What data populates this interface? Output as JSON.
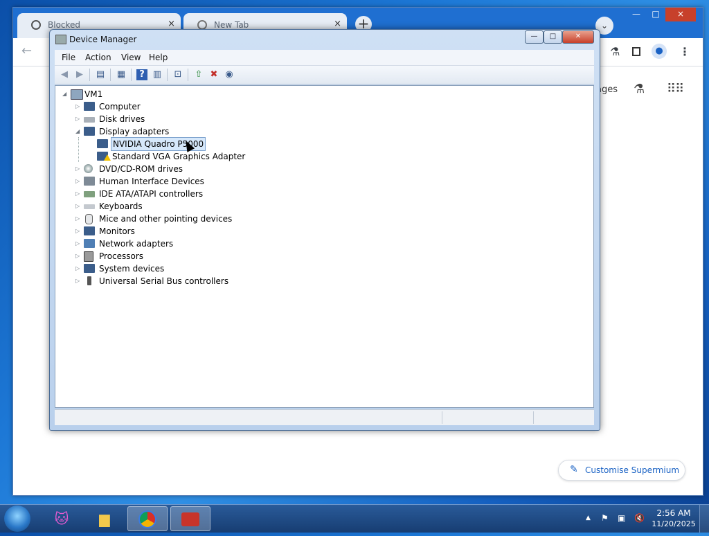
{
  "browser": {
    "tabs": [
      {
        "title": "Blocked",
        "icon": "blocked-icon",
        "close": "×"
      },
      {
        "title": "New Tab",
        "icon": "chrome-icon",
        "close": "×"
      }
    ],
    "new_tab": "+",
    "tab_search": "⌄",
    "window_controls": {
      "minimize": "—",
      "maximize": "□",
      "close": "×"
    },
    "toolbar": {
      "back": "←",
      "right_icons": [
        "flask-icon",
        "sidebar-icon",
        "profile-icon",
        "menu-icon"
      ]
    },
    "page": {
      "apps_label": "ages",
      "customise_label": "Customise Supermium"
    }
  },
  "device_manager": {
    "title": "Device Manager",
    "menu": [
      "File",
      "Action",
      "View",
      "Help"
    ],
    "window_controls": {
      "minimize": "—",
      "maximize": "□",
      "close": "✕"
    },
    "tree": {
      "root": "VM1",
      "categories": [
        {
          "label": "Computer",
          "icon": "computer-icon",
          "expanded": false
        },
        {
          "label": "Disk drives",
          "icon": "disk-drive-icon",
          "expanded": false
        },
        {
          "label": "Display adapters",
          "icon": "display-adapter-icon",
          "expanded": true,
          "children": [
            {
              "label": "NVIDIA Quadro P5000",
              "icon": "display-adapter-icon",
              "selected": true
            },
            {
              "label": "Standard VGA Graphics Adapter",
              "icon": "warning-display-icon",
              "warning": true
            }
          ]
        },
        {
          "label": "DVD/CD-ROM drives",
          "icon": "dvd-drive-icon",
          "expanded": false
        },
        {
          "label": "Human Interface Devices",
          "icon": "hid-icon",
          "expanded": false
        },
        {
          "label": "IDE ATA/ATAPI controllers",
          "icon": "ide-controller-icon",
          "expanded": false
        },
        {
          "label": "Keyboards",
          "icon": "keyboard-icon",
          "expanded": false
        },
        {
          "label": "Mice and other pointing devices",
          "icon": "mouse-icon",
          "expanded": false
        },
        {
          "label": "Monitors",
          "icon": "monitor-icon",
          "expanded": false
        },
        {
          "label": "Network adapters",
          "icon": "network-adapter-icon",
          "expanded": false
        },
        {
          "label": "Processors",
          "icon": "processor-icon",
          "expanded": false
        },
        {
          "label": "System devices",
          "icon": "system-device-icon",
          "expanded": false
        },
        {
          "label": "Universal Serial Bus controllers",
          "icon": "usb-icon",
          "expanded": false
        }
      ]
    },
    "colors": {
      "selection": "#d6e8fb",
      "selection_border": "#7da2ce"
    }
  },
  "taskbar": {
    "apps": [
      "start-orb",
      "cat-app-icon",
      "file-explorer-icon",
      "chrome-icon",
      "device-manager-icon"
    ],
    "clock": {
      "time": "2:56 AM",
      "date": "11/20/2025"
    },
    "tray": [
      "show-hidden-icon",
      "action-center-icon",
      "network-icon",
      "volume-muted-icon"
    ]
  }
}
